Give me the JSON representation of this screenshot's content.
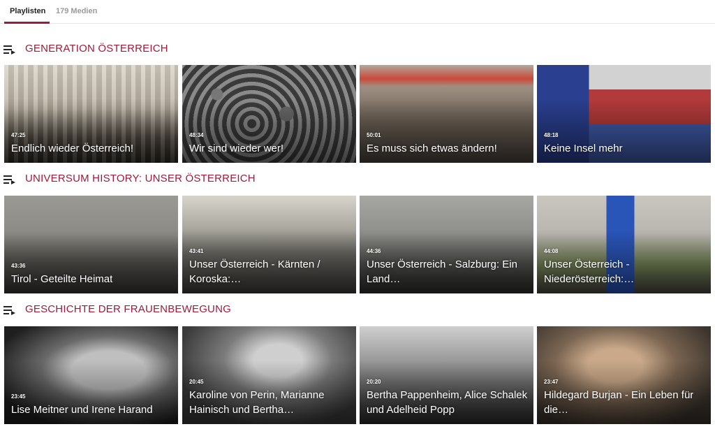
{
  "tabs": [
    {
      "label": "Playlisten",
      "active": true
    },
    {
      "label": "179 Medien",
      "active": false
    }
  ],
  "accent_color": "#9b1c3a",
  "sections": [
    {
      "title": "GENERATION ÖSTERREICH",
      "icon": "playlist-icon",
      "cards": [
        {
          "duration": "47:25",
          "title": "Endlich wieder Österreich!"
        },
        {
          "duration": "48:34",
          "title": "Wir sind wieder wer!"
        },
        {
          "duration": "50:01",
          "title": "Es muss sich etwas ändern!"
        },
        {
          "duration": "48:18",
          "title": "Keine Insel mehr"
        }
      ]
    },
    {
      "title": "UNIVERSUM HISTORY: UNSER ÖSTERREICH",
      "icon": "playlist-icon",
      "cards": [
        {
          "duration": "43:36",
          "title": "Tirol - Geteilte Heimat"
        },
        {
          "duration": "43:41",
          "title": "Unser Österreich - Kärnten / Koroska:…"
        },
        {
          "duration": "44:36",
          "title": "Unser Österreich - Salzburg: Ein Land…"
        },
        {
          "duration": "44:08",
          "title": "Unser Österreich - Niederösterreich:…"
        }
      ]
    },
    {
      "title": "GESCHICHTE DER FRAUENBEWEGUNG",
      "icon": "playlist-icon",
      "cards": [
        {
          "duration": "23:45",
          "title": "Lise Meitner und Irene Harand"
        },
        {
          "duration": "20:45",
          "title": "Karoline von Perin, Marianne Hainisch und Bertha…"
        },
        {
          "duration": "20:20",
          "title": "Bertha Pappenheim, Alice Schalek und Adelheid Popp"
        },
        {
          "duration": "23:47",
          "title": "Hildegard Burjan - Ein Leben für die…"
        }
      ]
    }
  ]
}
